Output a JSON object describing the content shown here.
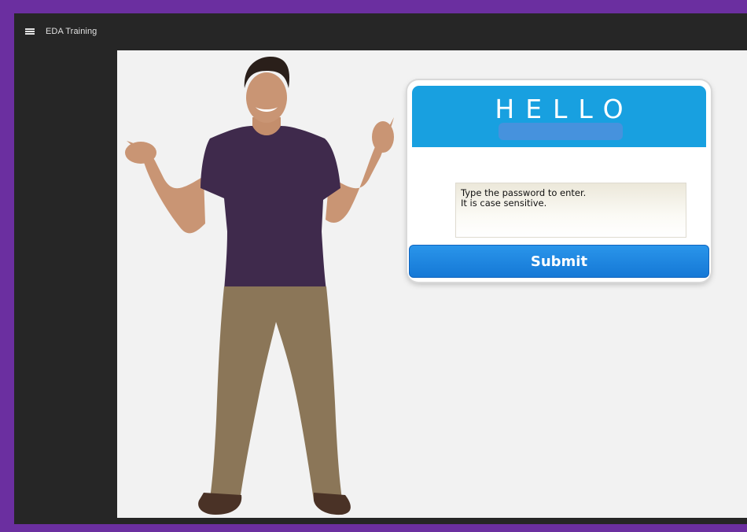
{
  "app": {
    "title": "EDA Training",
    "menu_icon": "hamburger-menu-icon"
  },
  "slide": {
    "name_tag": {
      "heading": "HELLO",
      "password_placeholder": "Type the password to enter.\nIt is case sensitive.",
      "password_value": "",
      "submit_label": "Submit"
    }
  },
  "colors": {
    "frame_border": "#6b2fa0",
    "app_background": "#262626",
    "slide_background": "#f2f2f2",
    "tag_header": "#18a0e0",
    "name_bar": "#4f8fdc",
    "submit_button": "#1a86e0"
  }
}
